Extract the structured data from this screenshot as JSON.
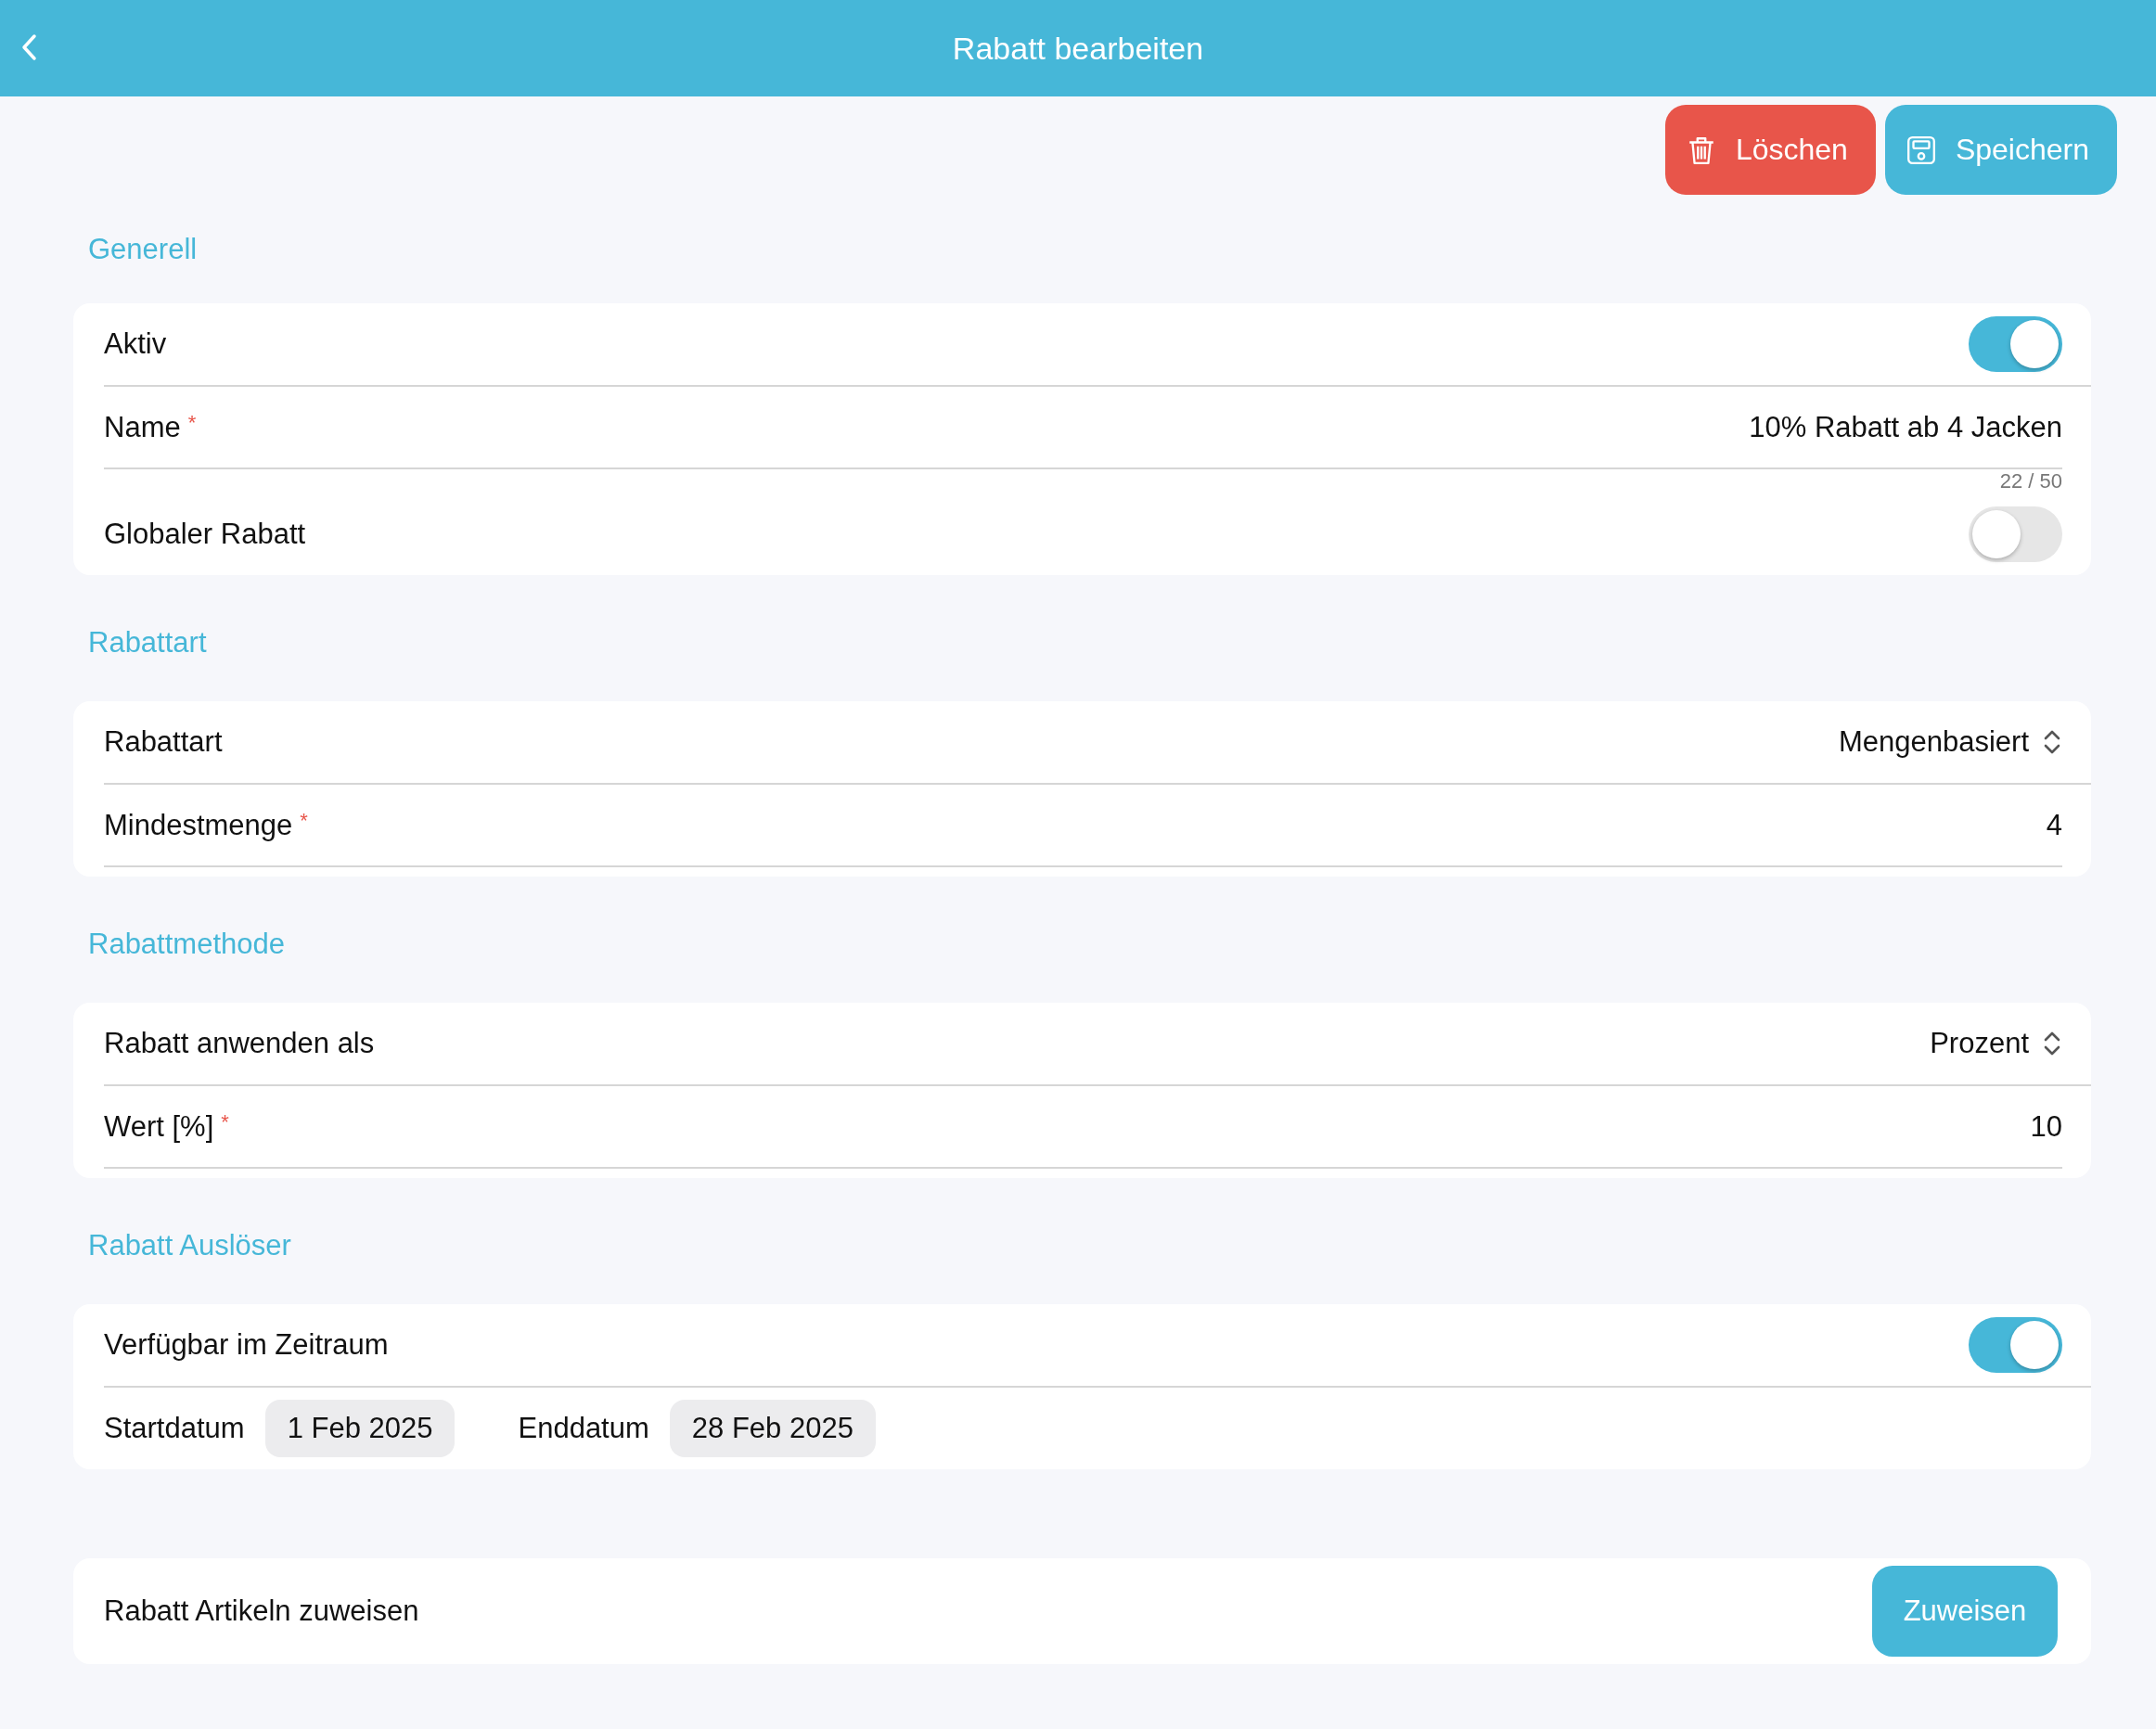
{
  "header": {
    "title": "Rabatt bearbeiten"
  },
  "actions": [
    {
      "kind": "delete",
      "label": "Löschen"
    },
    {
      "kind": "save",
      "label": "Speichern"
    }
  ],
  "sections": [
    {
      "title": "Generell",
      "rows": [
        {
          "kind": "toggle",
          "label": "Aktiv",
          "on": true
        },
        {
          "kind": "input",
          "label": "Name",
          "required_mark": "*",
          "value": "10% Rabatt ab 4 Jacken",
          "counter": "22 / 50"
        },
        {
          "kind": "toggle",
          "label": "Globaler Rabatt",
          "on": false
        }
      ]
    },
    {
      "title": "Rabattart",
      "rows": [
        {
          "kind": "select",
          "label": "Rabattart",
          "value": "Mengenbasiert"
        },
        {
          "kind": "input",
          "label": "Mindestmenge",
          "required_mark": "*",
          "value": "4"
        }
      ]
    },
    {
      "title": "Rabattmethode",
      "rows": [
        {
          "kind": "select",
          "label": "Rabatt anwenden als",
          "value": "Prozent"
        },
        {
          "kind": "input",
          "label": "Wert [%]",
          "required_mark": "*",
          "value": "10"
        }
      ]
    },
    {
      "title": "Rabatt Auslöser",
      "rows": [
        {
          "kind": "toggle",
          "label": "Verfügbar im Zeitraum",
          "on": true
        },
        {
          "kind": "dates",
          "start_label": "Startdatum",
          "start": "1 Feb 2025",
          "end_label": "Enddatum",
          "end": "28 Feb 2025"
        }
      ]
    }
  ],
  "assign": {
    "label": "Rabatt Artikeln zuweisen",
    "button": "Zuweisen"
  }
}
